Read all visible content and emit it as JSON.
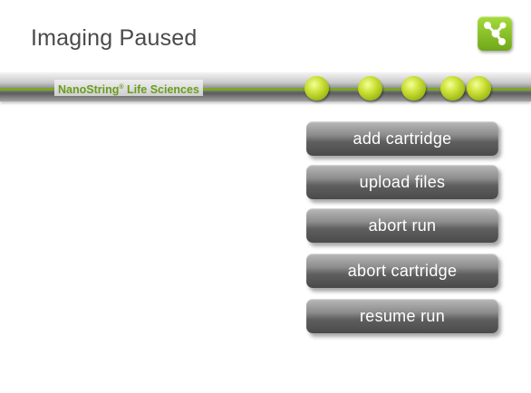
{
  "header": {
    "title": "Imaging Paused",
    "brand_name": "NanoString",
    "brand_mark": "®",
    "brand_suffix": " Life Sciences",
    "logo_icon": "network-nodes-icon"
  },
  "progress": {
    "total_steps": 5,
    "color": "#b7cf24"
  },
  "actions": [
    {
      "label": "add cartridge"
    },
    {
      "label": "upload files"
    },
    {
      "label": "abort run"
    },
    {
      "label": "abort cartridge"
    },
    {
      "label": "resume run"
    }
  ],
  "colors": {
    "accent_green": "#7aa823",
    "button_dark": "#4a4a4a"
  }
}
